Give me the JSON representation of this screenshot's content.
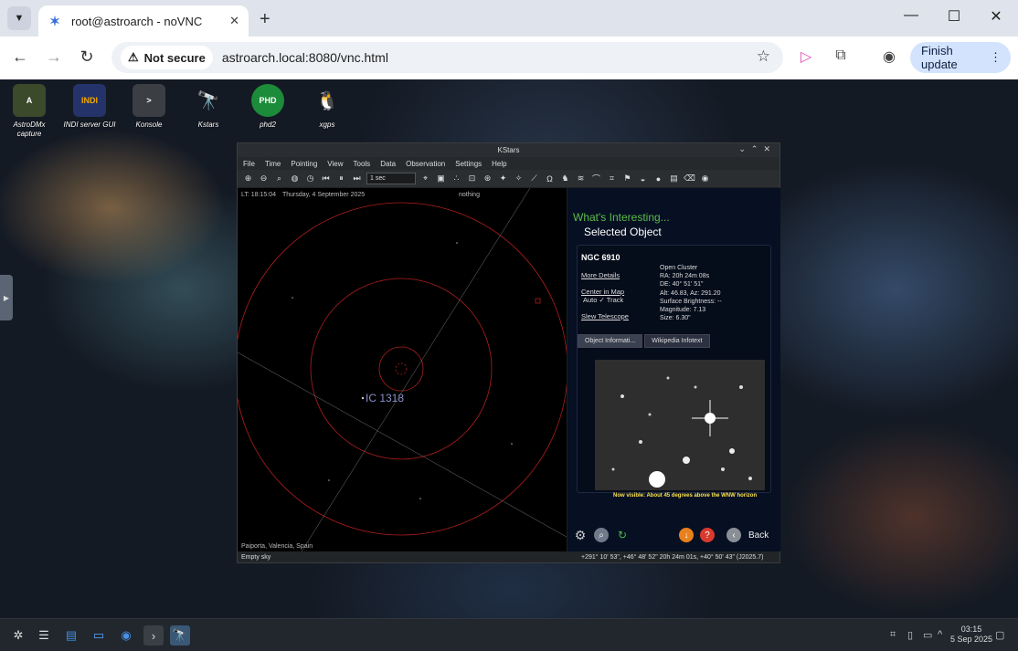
{
  "browser": {
    "tab_title": "root@astroarch - noVNC",
    "security_label": "Not secure",
    "url": "astroarch.local:8080/vnc.html",
    "finish_update": "Finish update"
  },
  "desktop_icons": [
    {
      "label": "AstroDMx capture",
      "icon": "astrodmx-icon"
    },
    {
      "label": "INDI server GUI",
      "icon": "indi-icon"
    },
    {
      "label": "Konsole",
      "icon": "terminal-icon"
    },
    {
      "label": "Kstars",
      "icon": "telescope-icon"
    },
    {
      "label": "phd2",
      "icon": "phd2-icon"
    },
    {
      "label": "xgps",
      "icon": "tux-icon"
    }
  ],
  "kstars": {
    "window_title": "KStars",
    "menu": [
      "File",
      "Time",
      "Pointing",
      "View",
      "Tools",
      "Data",
      "Observation",
      "Settings",
      "Help"
    ],
    "time_step": "1 sec",
    "sky": {
      "local_time": "LT: 18:15:04",
      "date": "Thursday, 4 September 2025",
      "focus": "nothing",
      "label_ic1318": "IC 1318",
      "location": "Paiporta, Valencia, Spain"
    },
    "panel": {
      "heading": "What's Interesting...",
      "subheading": "Selected Object",
      "object_name": "NGC 6910",
      "links": [
        "More Details",
        "Center in Map",
        "Slew Telescope"
      ],
      "auto_label": "Auto",
      "track_label": "Track",
      "props": [
        "Open Cluster",
        "RA: 20h 24m 08s",
        "DE: 40° 51' 51\"",
        "Alt: 46.83, Az: 291.20",
        "Surface Brightness: --",
        "Magnitude: 7.13",
        "Size: 6.30\""
      ],
      "tabs": [
        "Object Informati...",
        "Wikipedia Infotext"
      ],
      "visibility": "Now visible: About 45 degrees above the WNW horizon",
      "back": "Back"
    },
    "status_left": "Empty sky",
    "status_right": "+291° 10' 53\", +46° 48' 52\"  20h 24m 01s, +40° 50' 43\" (J2025.7)"
  },
  "taskbar": {
    "time": "03:15",
    "date": "5 Sep 2025"
  }
}
